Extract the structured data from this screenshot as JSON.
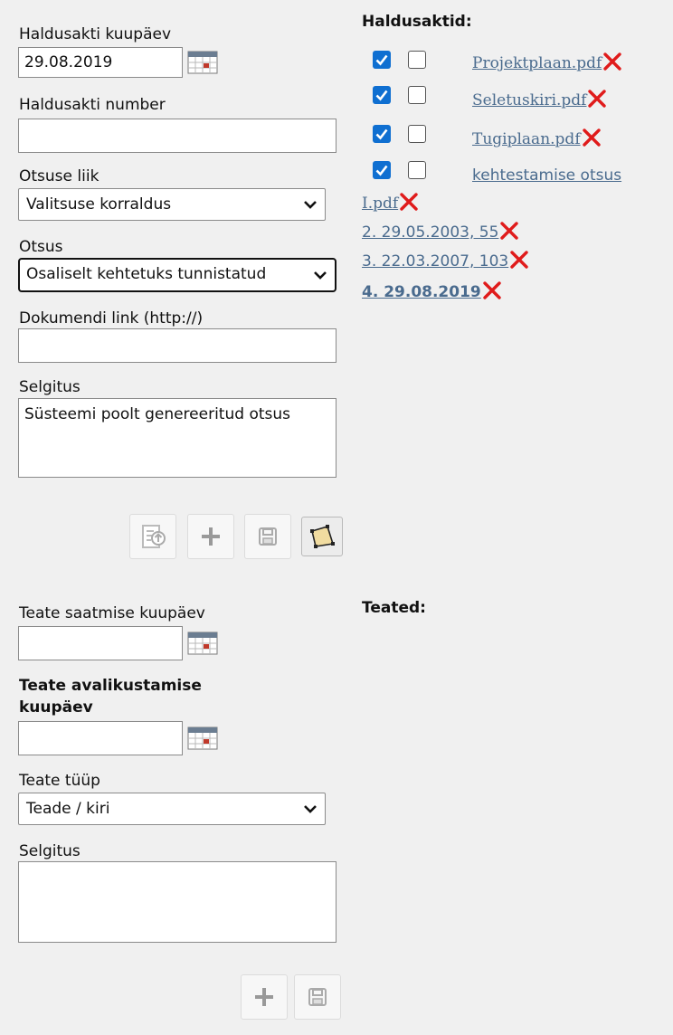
{
  "acts_form": {
    "date_label": "Haldusakti kuupäev",
    "date_value": "29.08.2019",
    "number_label": "Haldusakti number",
    "number_value": "",
    "decision_type_label": "Otsuse liik",
    "decision_type_value": "Valitsuse korraldus",
    "decision_label": "Otsus",
    "decision_value": "Osaliselt kehtetuks tunnistatud",
    "link_label": "Dokumendi link (http://)",
    "link_value": "",
    "explanation_label": "Selgitus",
    "explanation_value": "Süsteemi poolt genereeritud otsus",
    "toolbar_icons": [
      "upload-document-icon",
      "plus-icon",
      "save-icon",
      "map-area-icon"
    ]
  },
  "acts_list": {
    "heading": "Haldusaktid:",
    "files": [
      {
        "name": "Projektplaan.pdf",
        "checked_a": true,
        "checked_b": false
      },
      {
        "name": "Seletuskiri.pdf",
        "checked_a": true,
        "checked_b": false
      },
      {
        "name": "Tugiplaan.pdf",
        "checked_a": true,
        "checked_b": false
      },
      {
        "name_line1": "kehtestamise otsus",
        "name_line2": "I.pdf",
        "checked_a": true,
        "checked_b": false
      }
    ],
    "acts": [
      {
        "label": "2. 29.05.2003, 55"
      },
      {
        "label": "3. 22.03.2007, 103"
      },
      {
        "label": "4. 29.08.2019"
      }
    ],
    "delete_icon": "red-x-icon"
  },
  "notice_form": {
    "send_date_label": "Teate saatmise kuupäev",
    "send_date_value": "",
    "publish_date_label_line1": "Teate avalikustamise",
    "publish_date_label_line2": "kuupäev",
    "publish_date_value": "",
    "type_label": "Teate tüüp",
    "type_value": "Teade / kiri",
    "explanation_label": "Selgitus",
    "explanation_value": "",
    "toolbar_icons": [
      "plus-icon",
      "save-icon"
    ]
  },
  "notices_list": {
    "heading": "Teated:"
  },
  "colors": {
    "background": "#f0f0f0",
    "link": "#4a6b8e",
    "checkbox_checked": "#0f6fd1",
    "delete_x": "#e01b1b"
  }
}
